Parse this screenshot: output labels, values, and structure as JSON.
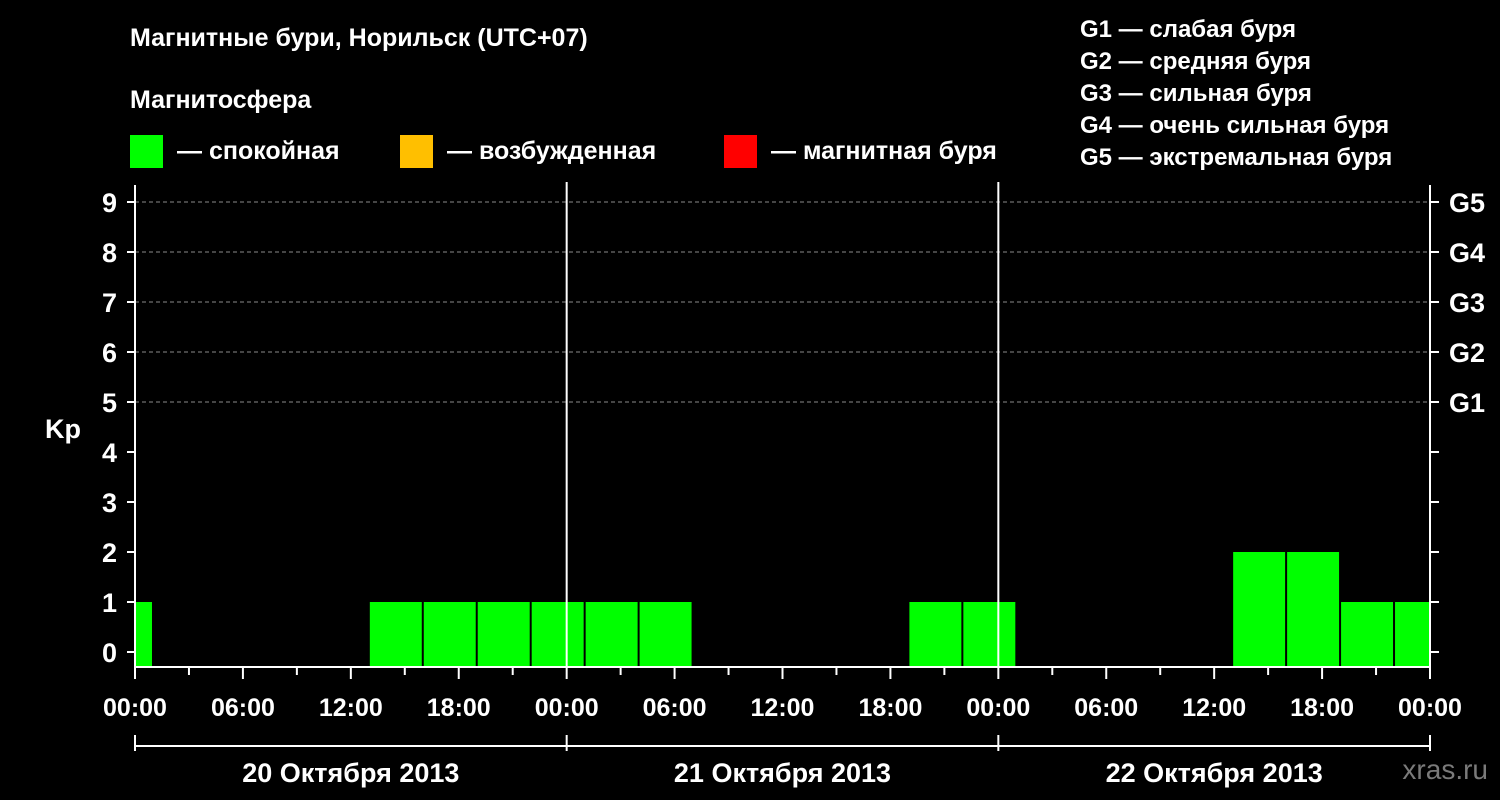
{
  "header": {
    "title": "Магнитные бури, Норильск (UTC+07)",
    "subtitle": "Магнитосфера"
  },
  "legend": [
    {
      "label": "— спокойная",
      "color": "#00ff00"
    },
    {
      "label": "— возбужденная",
      "color": "#ffbf00"
    },
    {
      "label": "— магнитная буря",
      "color": "#ff0000"
    }
  ],
  "storm_levels": [
    "G1 — слабая буря",
    "G2 — средняя буря",
    "G3 — сильная буря",
    "G4 — очень сильная буря",
    "G5 — экстремальная буря"
  ],
  "watermark": "xras.ru",
  "chart_data": {
    "type": "bar",
    "title": "Магнитные бури, Норильск (UTC+07)",
    "ylabel": "Kp",
    "ylim": [
      0,
      9
    ],
    "y_ticks": [
      "0",
      "1",
      "2",
      "3",
      "4",
      "5",
      "6",
      "7",
      "8",
      "9"
    ],
    "right_axis": [
      {
        "kp": 5,
        "label": "G1"
      },
      {
        "kp": 6,
        "label": "G2"
      },
      {
        "kp": 7,
        "label": "G3"
      },
      {
        "kp": 8,
        "label": "G4"
      },
      {
        "kp": 9,
        "label": "G5"
      }
    ],
    "grid": true,
    "x_hours_range": [
      0,
      72
    ],
    "x_tick_labels": [
      "00:00",
      "06:00",
      "12:00",
      "18:00",
      "00:00",
      "06:00",
      "12:00",
      "18:00",
      "00:00",
      "06:00",
      "12:00",
      "18:00",
      "00:00"
    ],
    "days": [
      "20 Октября 2013",
      "21 Октября 2013",
      "22 Октября 2013"
    ],
    "bar_color": "#00ff00",
    "bars": [
      {
        "start_hour": 0,
        "end_hour": 1,
        "kp": 1
      },
      {
        "start_hour": 13,
        "end_hour": 16,
        "kp": 1
      },
      {
        "start_hour": 16,
        "end_hour": 19,
        "kp": 1
      },
      {
        "start_hour": 19,
        "end_hour": 22,
        "kp": 1
      },
      {
        "start_hour": 22,
        "end_hour": 25,
        "kp": 1
      },
      {
        "start_hour": 25,
        "end_hour": 28,
        "kp": 1
      },
      {
        "start_hour": 28,
        "end_hour": 31,
        "kp": 1
      },
      {
        "start_hour": 43,
        "end_hour": 46,
        "kp": 1
      },
      {
        "start_hour": 46,
        "end_hour": 49,
        "kp": 1
      },
      {
        "start_hour": 61,
        "end_hour": 64,
        "kp": 2
      },
      {
        "start_hour": 64,
        "end_hour": 67,
        "kp": 2
      },
      {
        "start_hour": 67,
        "end_hour": 70,
        "kp": 1
      },
      {
        "start_hour": 70,
        "end_hour": 72,
        "kp": 1
      }
    ]
  }
}
